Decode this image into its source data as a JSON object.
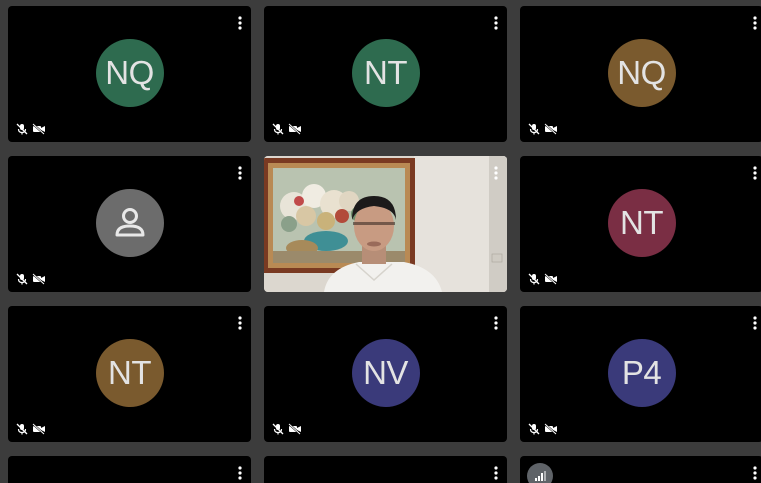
{
  "participants": [
    {
      "initials": "NQ",
      "color": "#2e6b4f",
      "mic": "muted",
      "camera": "off"
    },
    {
      "initials": "NT",
      "color": "#2e6b4f",
      "mic": "muted",
      "camera": "off"
    },
    {
      "initials": "NQ",
      "color": "#7a5a2e",
      "mic": "muted",
      "camera": "off"
    },
    {
      "initials": "",
      "color": "#6c6c6c",
      "mic": "muted",
      "camera": "off",
      "icon": "person-icon"
    },
    {
      "initials": "",
      "video": true,
      "icon": "live-video"
    },
    {
      "initials": "NT",
      "color": "#7a2e44",
      "mic": "muted",
      "camera": "off"
    },
    {
      "initials": "NT",
      "color": "#7a5a2e",
      "mic": "muted",
      "camera": "off"
    },
    {
      "initials": "NV",
      "color": "#3a3a7a",
      "mic": "muted",
      "camera": "off"
    },
    {
      "initials": "P4",
      "color": "#3a3a7a",
      "mic": "muted",
      "camera": "off"
    },
    {
      "initials": "",
      "partial": true
    },
    {
      "initials": "",
      "partial": true
    },
    {
      "initials": "",
      "partial": true,
      "icon": "signal-icon"
    }
  ],
  "colors": {
    "background": "#3c3c3c",
    "tile": "#000000",
    "icon": "#ffffff"
  }
}
